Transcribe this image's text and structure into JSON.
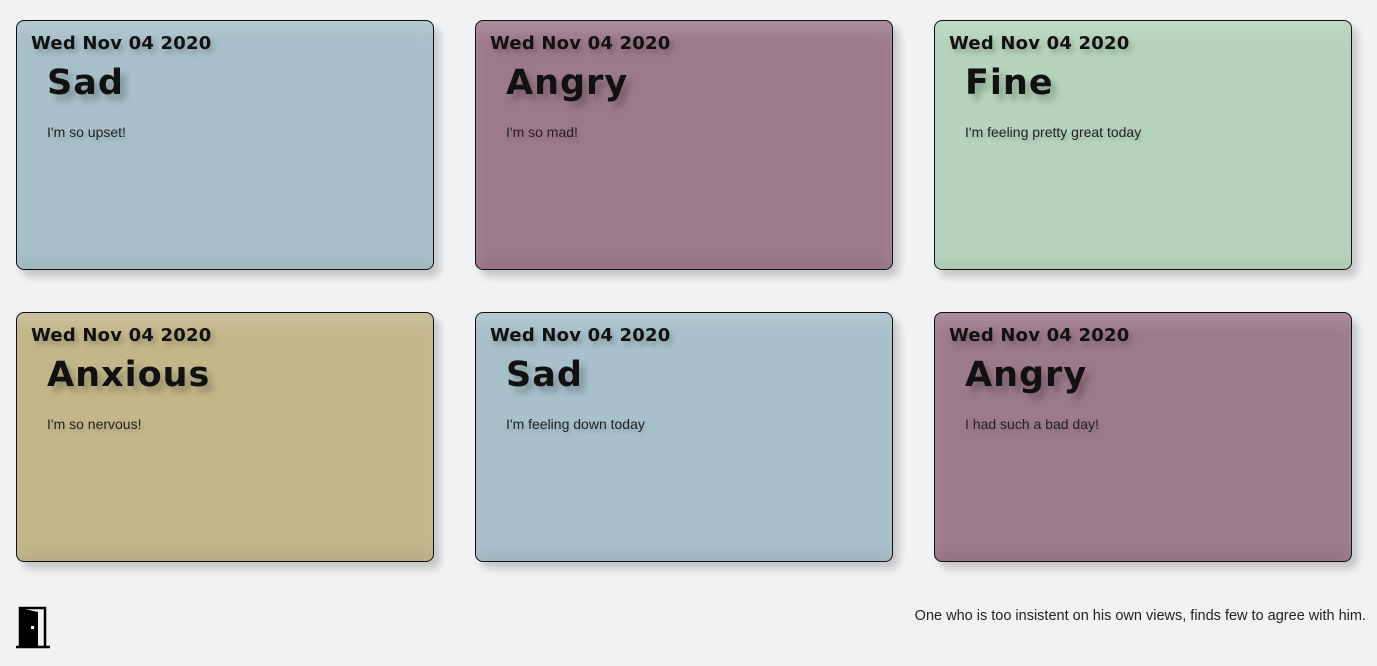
{
  "entries": [
    {
      "date": "Wed Nov 04 2020",
      "mood": "Sad",
      "note": "I'm so upset!",
      "color": "#a8c0ca"
    },
    {
      "date": "Wed Nov 04 2020",
      "mood": "Angry",
      "note": "I'm so mad!",
      "color": "#9d7a8b"
    },
    {
      "date": "Wed Nov 04 2020",
      "mood": "Fine",
      "note": "I'm feeling pretty great today",
      "color": "#b6d4bb"
    },
    {
      "date": "Wed Nov 04 2020",
      "mood": "Anxious",
      "note": "I'm so nervous!",
      "color": "#c3b78a"
    },
    {
      "date": "Wed Nov 04 2020",
      "mood": "Sad",
      "note": "I'm feeling down today",
      "color": "#a8c0ca"
    },
    {
      "date": "Wed Nov 04 2020",
      "mood": "Angry",
      "note": "I had such a bad day!",
      "color": "#9d7a8b"
    }
  ],
  "footer": {
    "logout_icon": "door-exit-icon",
    "quote": "One who is too insistent on his own views, finds few to agree with him."
  }
}
